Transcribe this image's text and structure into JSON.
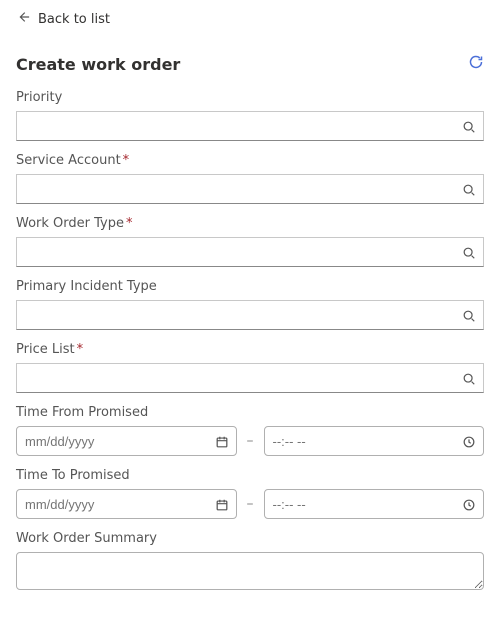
{
  "back_label": "Back to list",
  "page_title": "Create work order",
  "required_marker": "*",
  "separator": "–",
  "fields": {
    "priority": {
      "label": "Priority",
      "value": "",
      "required": false
    },
    "account": {
      "label": "Service Account",
      "value": "",
      "required": true
    },
    "wo_type": {
      "label": "Work Order Type",
      "value": "",
      "required": true
    },
    "incident": {
      "label": "Primary Incident Type",
      "value": "",
      "required": false
    },
    "price_list": {
      "label": "Price List",
      "value": "",
      "required": true
    },
    "time_from": {
      "label": "Time From Promised",
      "date_placeholder": "mm/dd/yyyy",
      "time_placeholder": "--:-- --"
    },
    "time_to": {
      "label": "Time To Promised",
      "date_placeholder": "mm/dd/yyyy",
      "time_placeholder": "--:-- --"
    },
    "summary": {
      "label": "Work Order Summary",
      "value": ""
    }
  }
}
